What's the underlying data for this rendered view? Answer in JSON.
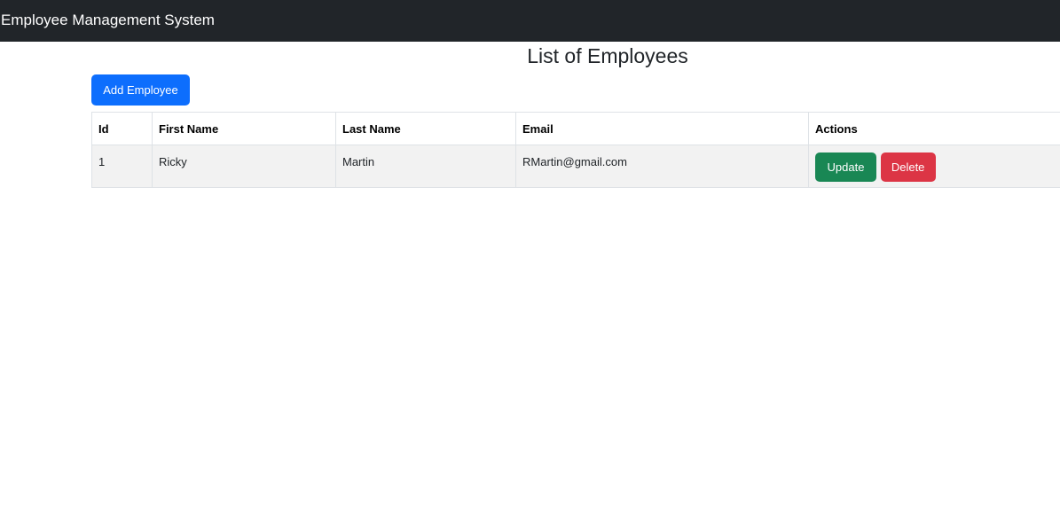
{
  "navbar": {
    "brand": "Employee Management System"
  },
  "main": {
    "title": "List of Employees",
    "add_button_label": "Add Employee",
    "table": {
      "headers": [
        "Id",
        "First Name",
        "Last Name",
        "Email",
        "Actions"
      ],
      "rows": [
        {
          "id": "1",
          "first_name": "Ricky",
          "last_name": "Martin",
          "email": "RMartin@gmail.com",
          "update_label": "Update",
          "delete_label": "Delete"
        }
      ]
    }
  },
  "colors": {
    "navbar_bg": "#212529",
    "primary": "#0d6efd",
    "success": "#198754",
    "danger": "#dc3545",
    "row_bg": "#f2f2f2"
  }
}
